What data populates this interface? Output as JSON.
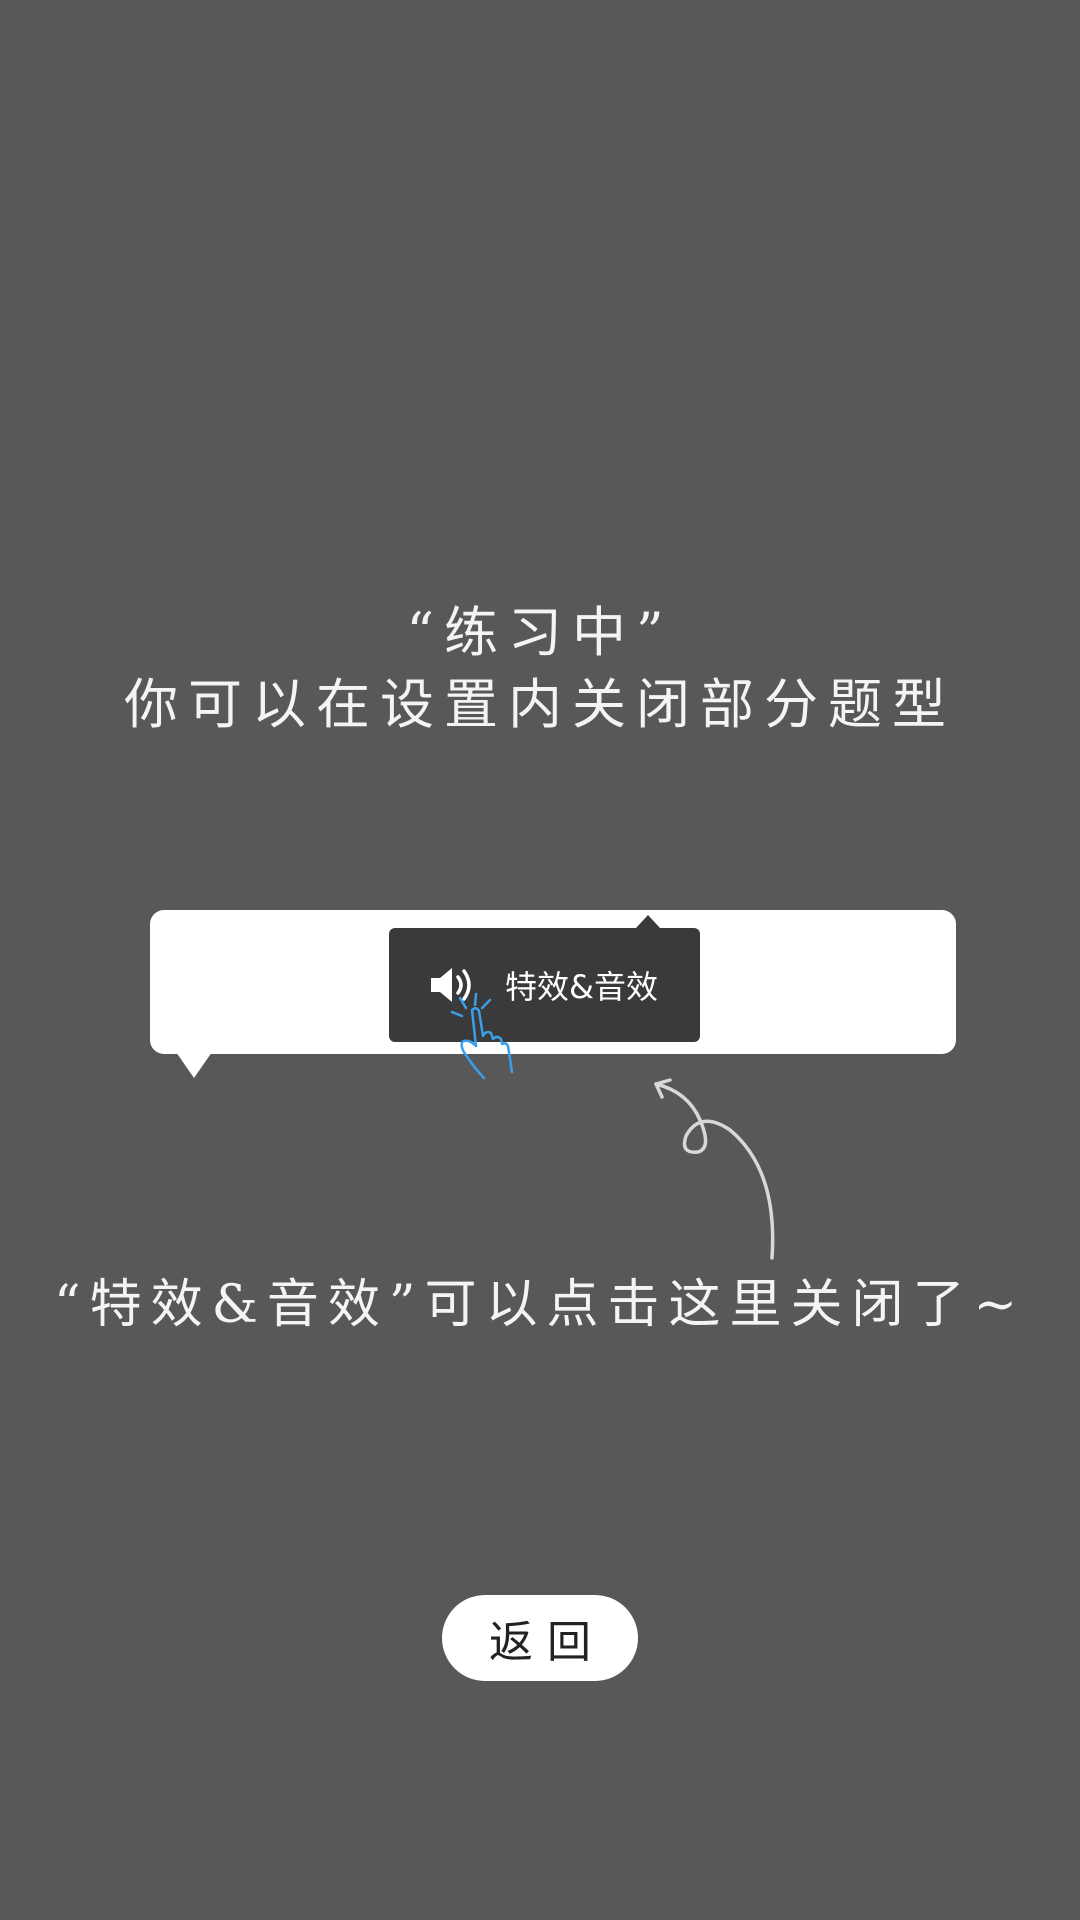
{
  "guide": {
    "title_line1": "“练习中”",
    "title_line2": "你可以在设置内关闭部分题型",
    "hint": "“特效&音效”可以点击这里关闭了~"
  },
  "settings_card": {
    "effects_button_label": "特效&音效",
    "effects_icon": "speaker-icon"
  },
  "back_button": {
    "label": "返回"
  },
  "colors": {
    "overlay": "#585858",
    "card": "#ffffff",
    "button_dark": "#3a3a3a",
    "tap_accent": "#3a9ee8"
  }
}
